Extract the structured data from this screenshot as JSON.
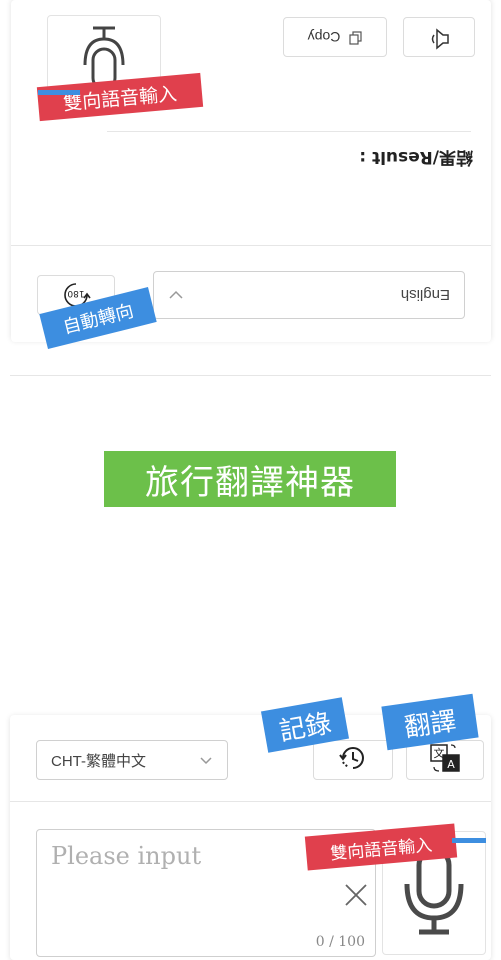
{
  "top_panel": {
    "copy_label": "Copy",
    "result_label": "結果/Result :",
    "language_value": "English",
    "rotate_icon_text": "180"
  },
  "labels": {
    "voice_top": "雙向語音輸入",
    "auto_rotate": "自動轉向",
    "title": "旅行翻譯神器",
    "history": "記錄",
    "translate": "翻譯",
    "voice_bottom": "雙向語音輸入"
  },
  "bottom_panel": {
    "language_value": "CHT-繁體中文",
    "input_placeholder": "Please input",
    "char_counter": "0 / 100"
  },
  "colors": {
    "red_brush": "#e0404d",
    "blue_brush": "#3d8ee0",
    "green_brush": "#6cc04a"
  },
  "icons": [
    "microphone-icon",
    "copy-icon",
    "speaker-icon",
    "chevron-down-icon",
    "rotate-180-icon",
    "history-icon",
    "translate-icon",
    "clear-icon"
  ]
}
